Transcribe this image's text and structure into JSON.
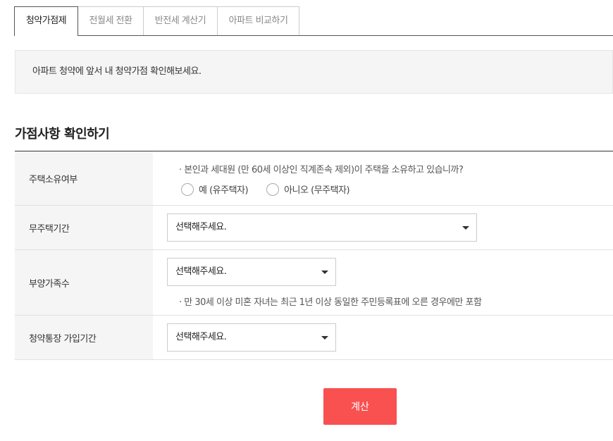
{
  "tabs": [
    {
      "label": "청약가점제"
    },
    {
      "label": "전월세 전환"
    },
    {
      "label": "반전세 계산기"
    },
    {
      "label": "아파트 비교하기"
    }
  ],
  "info_text": "아파트 청약에 앞서 내 청약가점 확인해보세요.",
  "section_title": "가점사항 확인하기",
  "rows": {
    "house_ownership": {
      "label": "주택소유여부",
      "question": "·  본인과 세대원 (만 60세 이상인 직계존속 제외)이 주택을 소유하고 있습니까?",
      "option_yes": "예 (유주택자)",
      "option_no": "아니오 (무주택자)"
    },
    "homeless_period": {
      "label": "무주택기간",
      "select_value": "선택해주세요."
    },
    "dependents": {
      "label": "부양가족수",
      "select_value": "선택해주세요.",
      "note": "·  만 30세 이상 미혼 자녀는 최근 1년 이상 동일한 주민등록표에 오른 경우에만 포함"
    },
    "account_period": {
      "label": "청약통장 가입기간",
      "select_value": "선택해주세요."
    }
  },
  "calculate_button": "계산",
  "colors": {
    "accent": "#f95050",
    "label_bg": "#f5f5f5"
  },
  "icons": {
    "select_caret": "caret-down-icon",
    "radio": "radio-circle-icon"
  }
}
